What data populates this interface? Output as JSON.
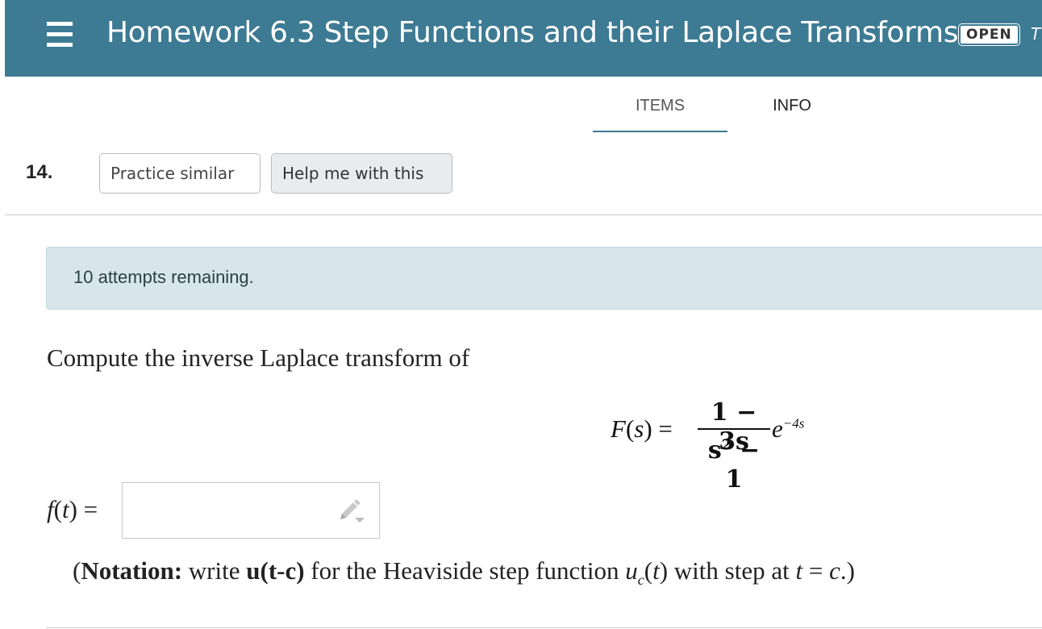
{
  "header": {
    "title": "Homework 6.3 Step Functions and their Laplace Transforms",
    "status_badge": "OPEN",
    "cut_text": "T",
    "menu_icon": "hamburger-menu-icon"
  },
  "tabs": [
    {
      "label": "ITEMS",
      "active": true
    },
    {
      "label": "INFO",
      "active": false
    }
  ],
  "question": {
    "number": "14.",
    "practice_label": "Practice similar",
    "help_label": "Help me with this",
    "attempts_text": "10 attempts remaining.",
    "prompt": "Compute the inverse Laplace transform of",
    "formula": {
      "lhs_fn": "F",
      "lhs_open": "(",
      "lhs_var": "s",
      "lhs_close": ")",
      "equals": " = ",
      "numerator": "1 − 3s",
      "denominator_base": "s",
      "denominator_exp": "2",
      "denominator_rest": " − 1",
      "exp_base": "e",
      "exp_power": "−4s"
    },
    "answer_label_fn": "f",
    "answer_label_open": "(",
    "answer_label_var": "t",
    "answer_label_close": ") =",
    "answer_value": "",
    "edit_icon": "pencil-icon",
    "notation": {
      "open": "(",
      "bold_label": "Notation:",
      "write": " write ",
      "code": "u(t-c)",
      "mid": " for the Heaviside step function ",
      "u": "u",
      "sub": "c",
      "paren_open": "(",
      "t": "t",
      "paren_close": ")",
      "tail": " with step at ",
      "t2": "t",
      "eq": " = ",
      "c": "c",
      "end": ".)"
    }
  },
  "colors": {
    "header_bg": "#3d7a93",
    "attempts_bg": "#d8e6eb",
    "help_button_bg": "#e9ecef"
  }
}
